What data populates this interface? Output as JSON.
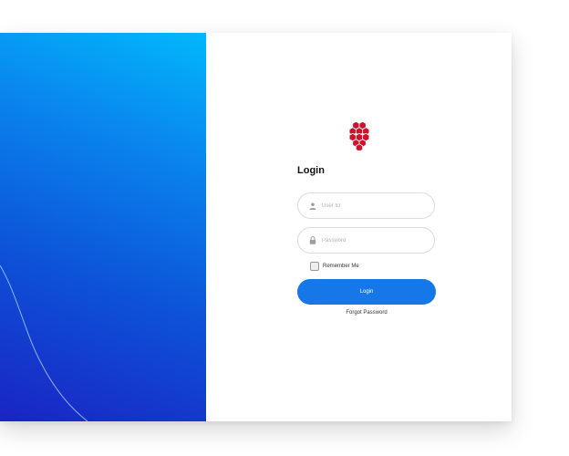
{
  "brand": {
    "logo_icon": "hexagon-cluster-logo",
    "logo_color": "#d0112b",
    "hero_gradient": [
      "#02b8fb",
      "#0a86ee",
      "#0d53d8",
      "#1a24c3"
    ]
  },
  "login": {
    "title": "Login",
    "user_id_placeholder": "User ID",
    "password_placeholder": "Password",
    "user_icon": "user-icon",
    "lock_icon": "lock-icon",
    "remember_label": "Remember Me",
    "remember_checked": false,
    "button_label": "Login",
    "button_color": "#1677e8",
    "forgot_label": "Forgot Password"
  }
}
